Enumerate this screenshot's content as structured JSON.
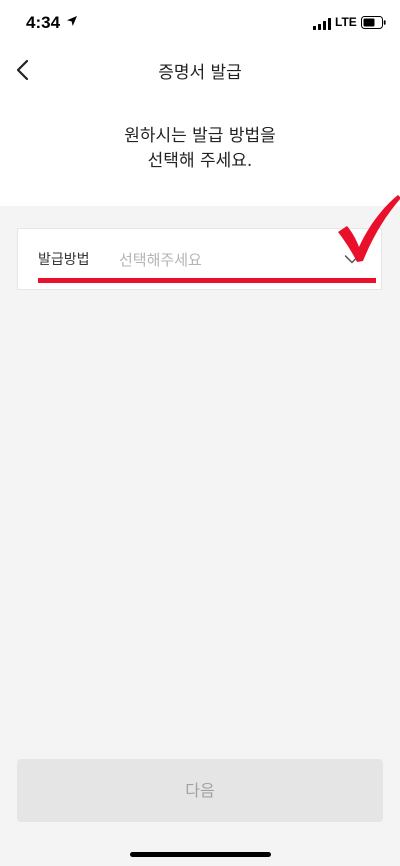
{
  "status_bar": {
    "time": "4:34",
    "network": "LTE",
    "location_icon": "location-arrow-icon",
    "signal_icon": "signal-bars-icon",
    "battery_icon": "battery-icon"
  },
  "header": {
    "title": "증명서 발급",
    "back_icon": "chevron-left-icon"
  },
  "guide": {
    "line1": "원하시는 발급 방법을",
    "line2": "선택해 주세요."
  },
  "method_select": {
    "label": "발급방법",
    "placeholder": "선택해주세요",
    "value": "",
    "icon": "chevron-down-icon"
  },
  "annotation": {
    "color": "#e8102a",
    "icon": "checkmark-icon"
  },
  "footer": {
    "next_label": "다음",
    "enabled": false
  },
  "colors": {
    "background": "#f4f4f4",
    "surface": "#ffffff",
    "disabled_button": "#e5e5e5",
    "disabled_text": "#a2a2a2",
    "accent": "#e8102a"
  }
}
